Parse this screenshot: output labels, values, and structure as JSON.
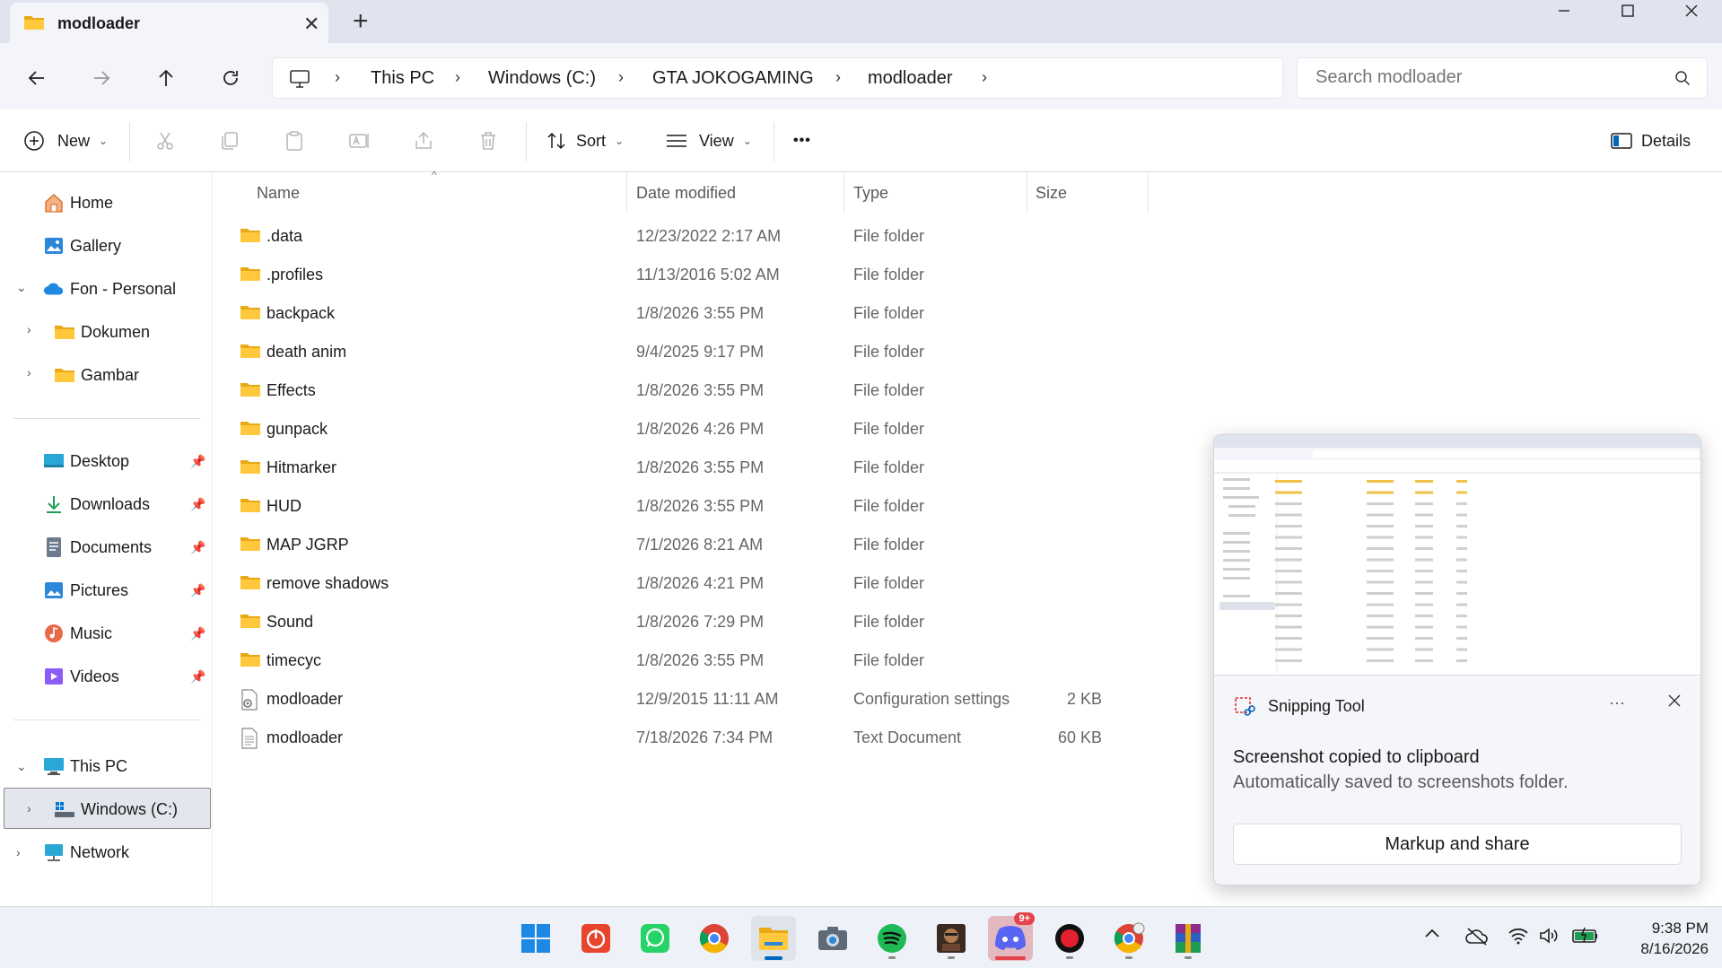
{
  "window": {
    "tab_title": "modloader",
    "new_tab": "+"
  },
  "nav": {
    "breadcrumb": [
      "This PC",
      "Windows (C:)",
      "GTA JOKOGAMING",
      "modloader"
    ],
    "search_placeholder": "Search modloader"
  },
  "toolbar": {
    "new_label": "New",
    "sort_label": "Sort",
    "view_label": "View",
    "more_label": "•••",
    "details_label": "Details"
  },
  "sidebar": {
    "quick": [
      {
        "label": "Home",
        "icon": "home-icon"
      },
      {
        "label": "Gallery",
        "icon": "gallery-icon"
      },
      {
        "label": "Fon - Personal",
        "icon": "onedrive-icon"
      },
      {
        "label": "Dokumen",
        "icon": "folder-icon"
      },
      {
        "label": "Gambar",
        "icon": "folder-icon"
      }
    ],
    "pinned": [
      {
        "label": "Desktop",
        "icon": "desktop-icon"
      },
      {
        "label": "Downloads",
        "icon": "downloads-icon"
      },
      {
        "label": "Documents",
        "icon": "documents-icon"
      },
      {
        "label": "Pictures",
        "icon": "pictures-icon"
      },
      {
        "label": "Music",
        "icon": "music-icon"
      },
      {
        "label": "Videos",
        "icon": "videos-icon"
      }
    ],
    "drives": [
      {
        "label": "This PC",
        "icon": "pc-icon"
      },
      {
        "label": "Windows (C:)",
        "icon": "drive-icon"
      },
      {
        "label": "Network",
        "icon": "network-icon"
      }
    ]
  },
  "columns": {
    "name": "Name",
    "date": "Date modified",
    "type": "Type",
    "size": "Size"
  },
  "files": [
    {
      "name": ".data",
      "date": "12/23/2022 2:17 AM",
      "type": "File folder",
      "size": "",
      "kind": "folder"
    },
    {
      "name": ".profiles",
      "date": "11/13/2016 5:02 AM",
      "type": "File folder",
      "size": "",
      "kind": "folder"
    },
    {
      "name": "backpack",
      "date": "1/8/2026 3:55 PM",
      "type": "File folder",
      "size": "",
      "kind": "folder"
    },
    {
      "name": "death anim",
      "date": "9/4/2025 9:17 PM",
      "type": "File folder",
      "size": "",
      "kind": "folder"
    },
    {
      "name": "Effects",
      "date": "1/8/2026 3:55 PM",
      "type": "File folder",
      "size": "",
      "kind": "folder"
    },
    {
      "name": "gunpack",
      "date": "1/8/2026 4:26 PM",
      "type": "File folder",
      "size": "",
      "kind": "folder"
    },
    {
      "name": "Hitmarker",
      "date": "1/8/2026 3:55 PM",
      "type": "File folder",
      "size": "",
      "kind": "folder"
    },
    {
      "name": "HUD",
      "date": "1/8/2026 3:55 PM",
      "type": "File folder",
      "size": "",
      "kind": "folder"
    },
    {
      "name": "MAP JGRP",
      "date": "7/1/2026 8:21 AM",
      "type": "File folder",
      "size": "",
      "kind": "folder"
    },
    {
      "name": "remove shadows",
      "date": "1/8/2026 4:21 PM",
      "type": "File folder",
      "size": "",
      "kind": "folder"
    },
    {
      "name": "Sound",
      "date": "1/8/2026 7:29 PM",
      "type": "File folder",
      "size": "",
      "kind": "folder"
    },
    {
      "name": "timecyc",
      "date": "1/8/2026 3:55 PM",
      "type": "File folder",
      "size": "",
      "kind": "folder"
    },
    {
      "name": "modloader",
      "date": "12/9/2015 11:11 AM",
      "type": "Configuration settings",
      "size": "2 KB",
      "kind": "config"
    },
    {
      "name": "modloader",
      "date": "7/18/2026 7:34 PM",
      "type": "Text Document",
      "size": "60 KB",
      "kind": "text"
    }
  ],
  "toast": {
    "app_name": "Snipping Tool",
    "more": "···",
    "title": "Screenshot copied to clipboard",
    "subtitle": "Automatically saved to screenshots folder.",
    "button": "Markup and share"
  },
  "taskbar": {
    "apps": [
      "start-icon",
      "office-icon",
      "whatsapp-icon",
      "chrome-icon",
      "file-explorer-icon",
      "camera-icon",
      "spotify-icon",
      "game-icon",
      "discord-icon",
      "obs-icon",
      "chrome-dev-icon",
      "winrar-icon"
    ],
    "discord_badge": "9+",
    "time": "9:38 PM",
    "date": "8/16/2026"
  },
  "colors": {
    "accent": "#0067c0",
    "folder": "#ffc83d",
    "folder_dark": "#e8a914"
  }
}
